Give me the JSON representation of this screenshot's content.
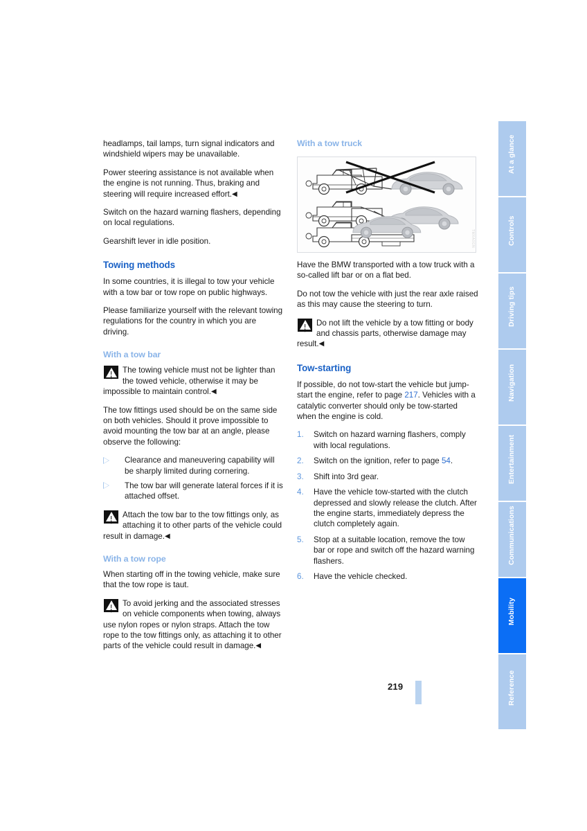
{
  "document": {
    "page_number": "219",
    "figure_code": "TMXA0GN"
  },
  "left_column": {
    "intro_paragraphs": [
      "headlamps, tail lamps, turn signal indicators and windshield wipers may be unavailable.",
      "Power steering assistance is not available when the engine is not running. Thus, braking and steering will require increased effort.",
      "Switch on the hazard warning flashers, depending on local regulations.",
      "Gearshift lever in idle position."
    ],
    "towing_methods": {
      "heading": "Towing methods",
      "paragraphs": [
        "In some countries, it is illegal to tow your vehicle with a tow bar or tow rope on public highways.",
        "Please familiarize yourself with the relevant towing regulations for the country in which you are driving."
      ]
    },
    "tow_bar": {
      "heading": "With a tow bar",
      "warning": "The towing vehicle must not be lighter than the towed vehicle, otherwise it may be impossible to maintain control.",
      "paragraph": "The tow fittings used should be on the same side on both vehicles. Should it prove impossible to avoid mounting the tow bar at an angle, please observe the following:",
      "bullets": [
        "Clearance and maneuvering capability will be sharply limited during cornering.",
        "The tow bar will generate lateral forces if it is attached offset."
      ],
      "warning2": "Attach the tow bar to the tow fittings only, as attaching it to other parts of the vehicle could result in damage."
    },
    "tow_rope": {
      "heading": "With a tow rope",
      "paragraph": "When starting off in the towing vehicle, make sure that the tow rope is taut.",
      "warning": "To avoid jerking and the associated stresses on vehicle components when towing, always use nylon ropes or nylon straps. Attach the tow rope to the tow fittings only, as attaching it to other parts of the vehicle could result in damage."
    }
  },
  "right_column": {
    "tow_truck": {
      "heading": "With a tow truck",
      "paragraphs": [
        "Have the BMW transported with a tow truck with a so-called lift bar or on a flat bed.",
        "Do not tow the vehicle with just the rear axle raised as this may cause the steering to turn."
      ],
      "warning": "Do not lift the vehicle by a tow fitting or body and chassis parts, otherwise damage may result."
    },
    "tow_starting": {
      "heading": "Tow-starting",
      "intro_part1": "If possible, do not tow-start the vehicle but jump-start the engine, refer to page ",
      "intro_ref1": "217",
      "intro_part2": ". Vehicles with a catalytic converter should only be tow-started when the engine is cold.",
      "steps": [
        {
          "num": "1.",
          "text": "Switch on hazard warning flashers, comply with local regulations."
        },
        {
          "num": "2.",
          "text_before": "Switch on the ignition, refer to page ",
          "ref": "54",
          "text_after": "."
        },
        {
          "num": "3.",
          "text": "Shift into 3rd gear."
        },
        {
          "num": "4.",
          "text": "Have the vehicle tow-started with the clutch depressed and slowly release the clutch. After the engine starts, immediately depress the clutch completely again."
        },
        {
          "num": "5.",
          "text": "Stop at a suitable location, remove the tow bar or rope and switch off the hazard warning flashers."
        },
        {
          "num": "6.",
          "text": "Have the vehicle checked."
        }
      ]
    }
  },
  "sidebar_tabs": [
    {
      "label": "At a glance",
      "active": false
    },
    {
      "label": "Controls",
      "active": false
    },
    {
      "label": "Driving tips",
      "active": false
    },
    {
      "label": "Navigation",
      "active": false
    },
    {
      "label": "Entertainment",
      "active": false
    },
    {
      "label": "Communications",
      "active": false
    },
    {
      "label": "Mobility",
      "active": true
    },
    {
      "label": "Reference",
      "active": false
    }
  ],
  "colors": {
    "heading_blue": "#1b62c6",
    "subheading_blue": "#8ab4e8",
    "tab_inactive": "#aecbee",
    "tab_active": "#0b6ef5",
    "link_blue": "#2f6fd0",
    "page_bar": "#b9d3f0"
  },
  "end_marker": "◀"
}
